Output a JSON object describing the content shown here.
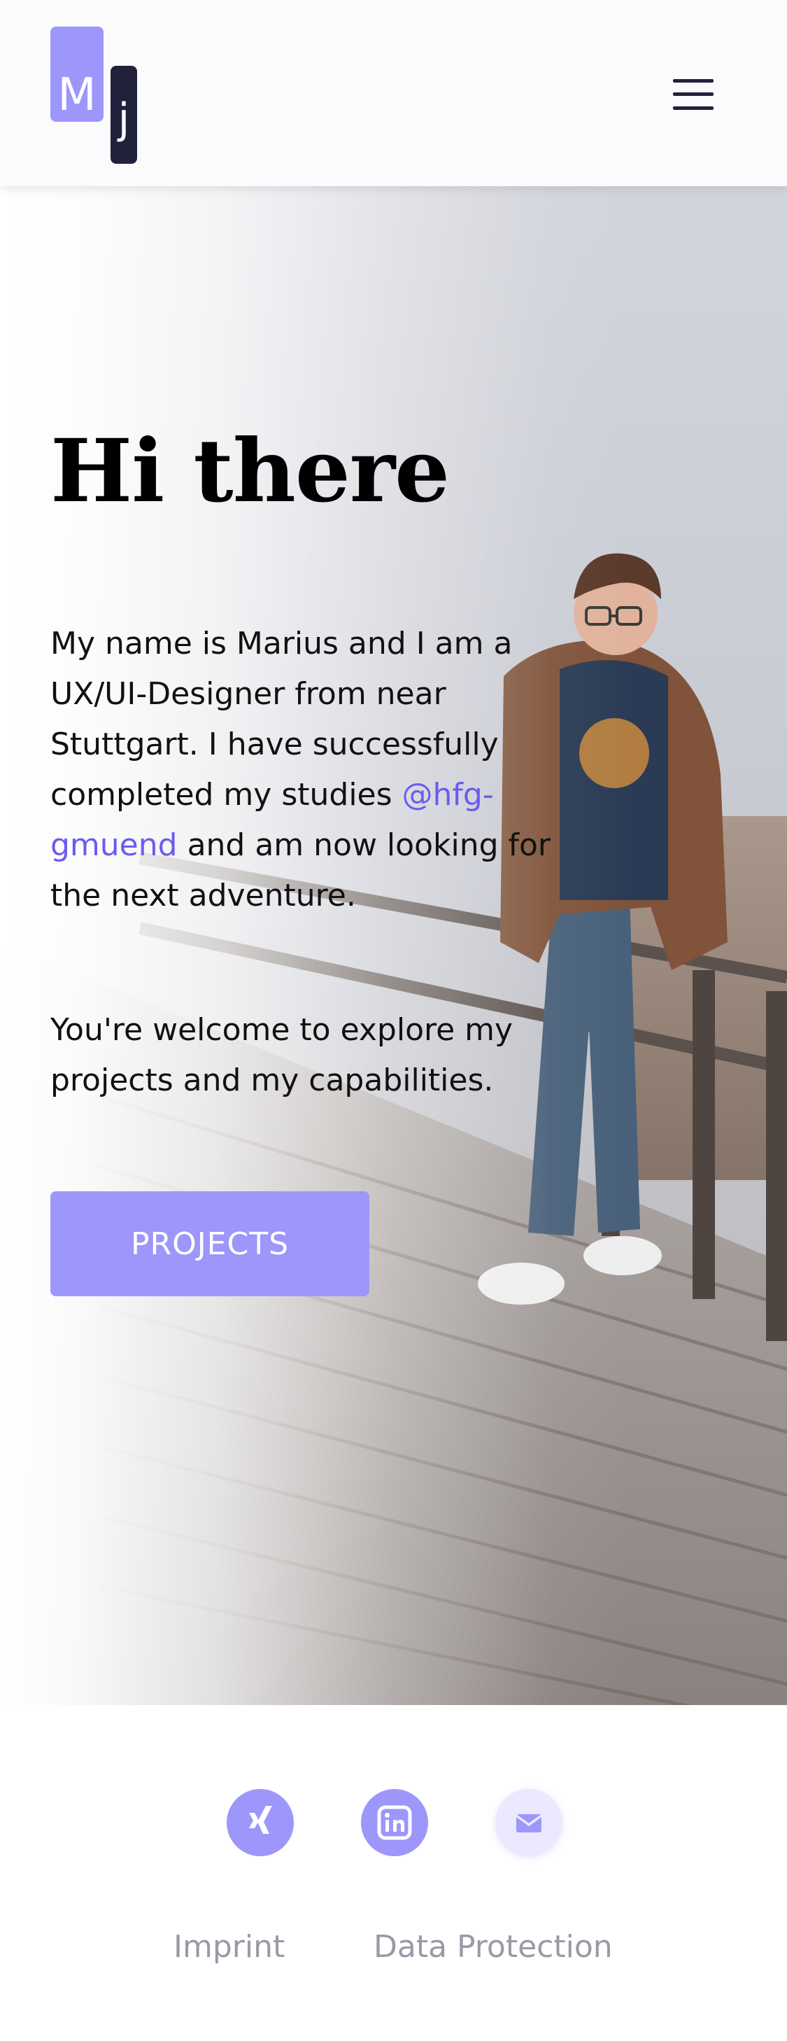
{
  "header": {
    "logo": {
      "letter_m": "M",
      "letter_j": "j"
    },
    "menu_icon": "hamburger-menu-icon"
  },
  "hero": {
    "title": "Hi there",
    "intro_before_link": "My name is Marius and I am a UX/UI-Designer from near Stuttgart. I have successfully completed my studies ",
    "intro_link": "@hfg-gmuend",
    "intro_after_link": " and am now looking for the next adventure.",
    "welcome": "You're welcome to explore my projects and my capabilities.",
    "cta_label": "PROJECTS"
  },
  "footer": {
    "social": [
      {
        "name": "xing",
        "icon": "xing-icon"
      },
      {
        "name": "linkedin",
        "icon": "linkedin-icon"
      },
      {
        "name": "mail",
        "icon": "mail-icon"
      }
    ],
    "links": {
      "imprint": "Imprint",
      "privacy": "Data Protection"
    }
  },
  "colors": {
    "accent": "#9d96fb",
    "accent_light": "#ece9fe",
    "dark": "#22213b",
    "link": "#6b5bf0",
    "footer_text": "#9a9aa6"
  }
}
